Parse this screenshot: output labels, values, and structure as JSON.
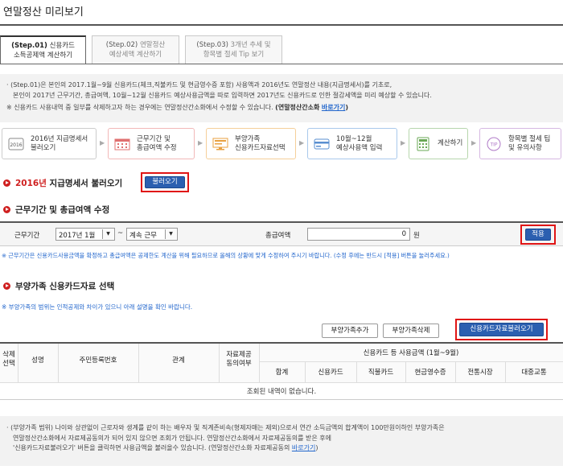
{
  "page": {
    "title": "연말정산 미리보기"
  },
  "tabs": [
    {
      "step": "(Step.01)",
      "line1": "신용카드",
      "line2": "소득공제액 계산하기"
    },
    {
      "step": "(Step.02)",
      "line1": "연말정산",
      "line2": "예상세액 계산하기"
    },
    {
      "step": "(Step.03)",
      "line1": "3개년 추세 및",
      "line2": "항목별 절세 Tip 보기"
    }
  ],
  "info": {
    "line1": "· (Step.01)은 본인의 2017.1월~9월 신용카드(체크,직불카드 및 현금영수증 포함) 사용액과 2016년도 연말정산 내용(지급명세서)를 기초로,",
    "line2": "본인이 2017년 근무기간, 총급여액, 10월~12월 신용카드 예상사용금액을 따로 입력하면 2017년도 신용카드로 인한 절감세액을 미리 예상할 수 있습니다.",
    "line3_prefix": "※ 신용카드 사용내역 중 일부를 삭제하고자 하는 경우에는 연말정산간소화에서 수정할 수 있습니다.",
    "line3_bold": "(연말정산간소화",
    "line3_link": "바로가기",
    "line3_suffix": ")"
  },
  "steps": [
    {
      "icon": "2016",
      "line1": "2016년 지급명세서",
      "line2": "불러오기"
    },
    {
      "icon": "calendar",
      "line1": "근무기간 및",
      "line2": "총급여액 수정"
    },
    {
      "icon": "monitor",
      "line1": "부양가족",
      "line2": "신용카드자료선택"
    },
    {
      "icon": "card",
      "line1": "10월~12월",
      "line2": "예상사용액 입력"
    },
    {
      "icon": "calculator",
      "line1": "계산하기",
      "line2": ""
    },
    {
      "icon": "tip",
      "line1": "항목별 절세 팁",
      "line2": "및 유의사항"
    }
  ],
  "section1": {
    "year": "2016년",
    "title": " 지급명세서 불러오기",
    "button": "불러오기"
  },
  "section2": {
    "title": "근무기간 및 총급여액 수정",
    "period_label": "근무기간",
    "period_start": "2017년 1월",
    "tilde": "~",
    "period_end": "계속 근무",
    "salary_label": "총급여액",
    "salary_value": "0",
    "salary_unit": "원",
    "apply_button": "적용",
    "note": "※ 근무기간은 신용카드사용금액을 확정하고 총급여액은 공제한도 계산을 위해 필요하므로 올해의 상황에 맞게 수정하여 주시기 바랍니다. (수정 후에는 반드시 [적용] 버튼을 눌러주세요.)"
  },
  "section3": {
    "title": "부양가족 신용카드자료 선택",
    "note": "※ 부양가족의 범위는 인적공제와 차이가 있으니 아래 설명을 확인 바랍니다.",
    "add_button": "부양가족추가",
    "delete_button": "부양가족삭제",
    "load_button": "신용카드자료불러오기"
  },
  "table": {
    "col_delete": [
      "삭제",
      "선택"
    ],
    "col_name": "성명",
    "col_id": "주민등록번호",
    "col_relation": "관계",
    "col_share": [
      "자료제공",
      "동의여부"
    ],
    "group_header": "신용카드 등 사용금액 (1월~9월)",
    "sub_headers": [
      "합계",
      "신용카드",
      "직불카드",
      "현금영수증",
      "전통시장",
      "대중교통"
    ],
    "empty_message": "조회된 내역이 없습니다."
  },
  "bottom": {
    "line1": "· (부양가족 범위) 나이와 상관없이 근로자와 생계를 같이 하는 배우자 및 직계존비속(형제자매는 제외)으로서 연간 소득금액의 합계액이 100만원이하인 부양가족은",
    "line2": "연말정산간소화에서 자료제공동의가 되어 있지 않으면 조회가 안됩니다. 연말정산간소화에서 자료제공동의를 받은 후에",
    "line3_prefix": "'신용카드자료불러오기' 버튼을 클릭하면 사용금액을 불러올수 있습니다. (연말정산간소화 자료제공동의",
    "line3_link": "바로가기",
    "line3_suffix": ")"
  }
}
